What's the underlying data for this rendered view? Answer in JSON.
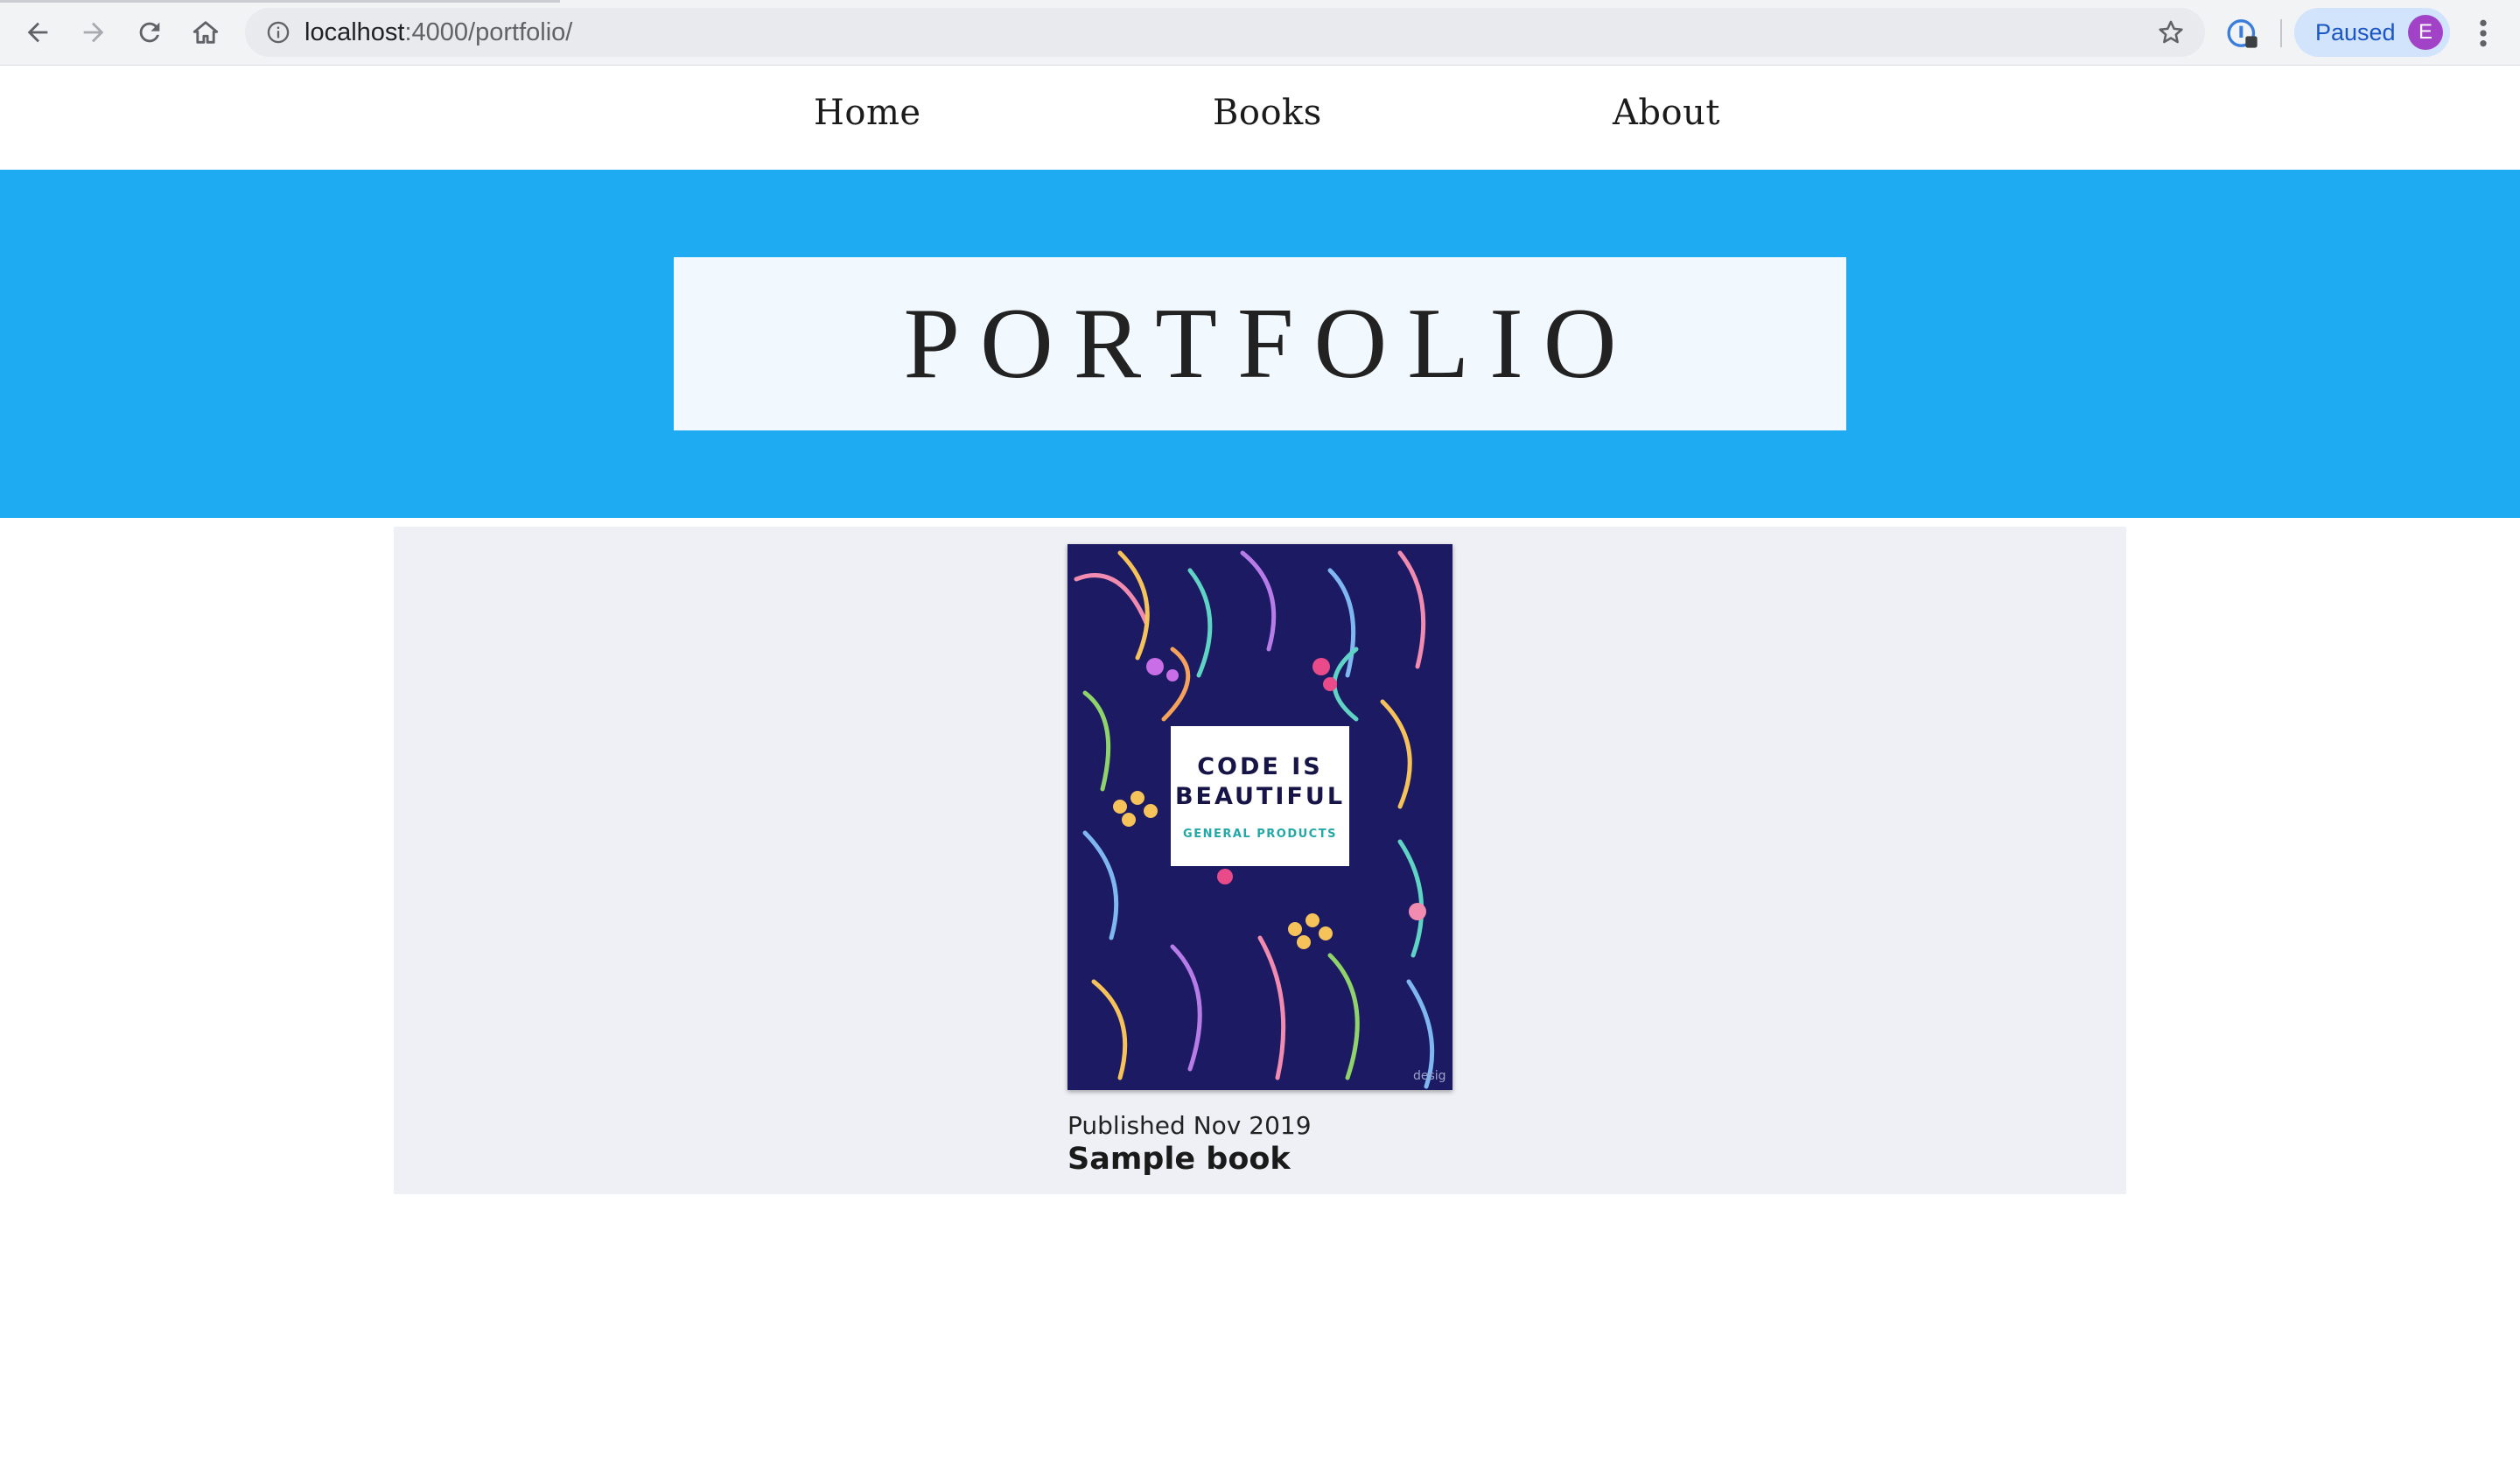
{
  "browser": {
    "url_host": "localhost",
    "url_rest": ":4000/portfolio/",
    "profile_status": "Paused",
    "profile_initial": "E",
    "icons": [
      "back-arrow-icon",
      "forward-arrow-icon",
      "reload-icon",
      "home-icon",
      "info-icon",
      "star-icon",
      "extension-icon",
      "more-vertical-icon"
    ]
  },
  "nav": {
    "items": [
      {
        "label": "Home"
      },
      {
        "label": "Books"
      },
      {
        "label": "About"
      }
    ]
  },
  "hero": {
    "title": "PORTFOLIO",
    "background": "#1fabf2"
  },
  "books": [
    {
      "cover_line1": "CODE IS",
      "cover_line2": "BEAUTIFUL",
      "cover_line3": "GENERAL PRODUCTS",
      "published": "Published Nov 2019",
      "title": "Sample book"
    }
  ]
}
